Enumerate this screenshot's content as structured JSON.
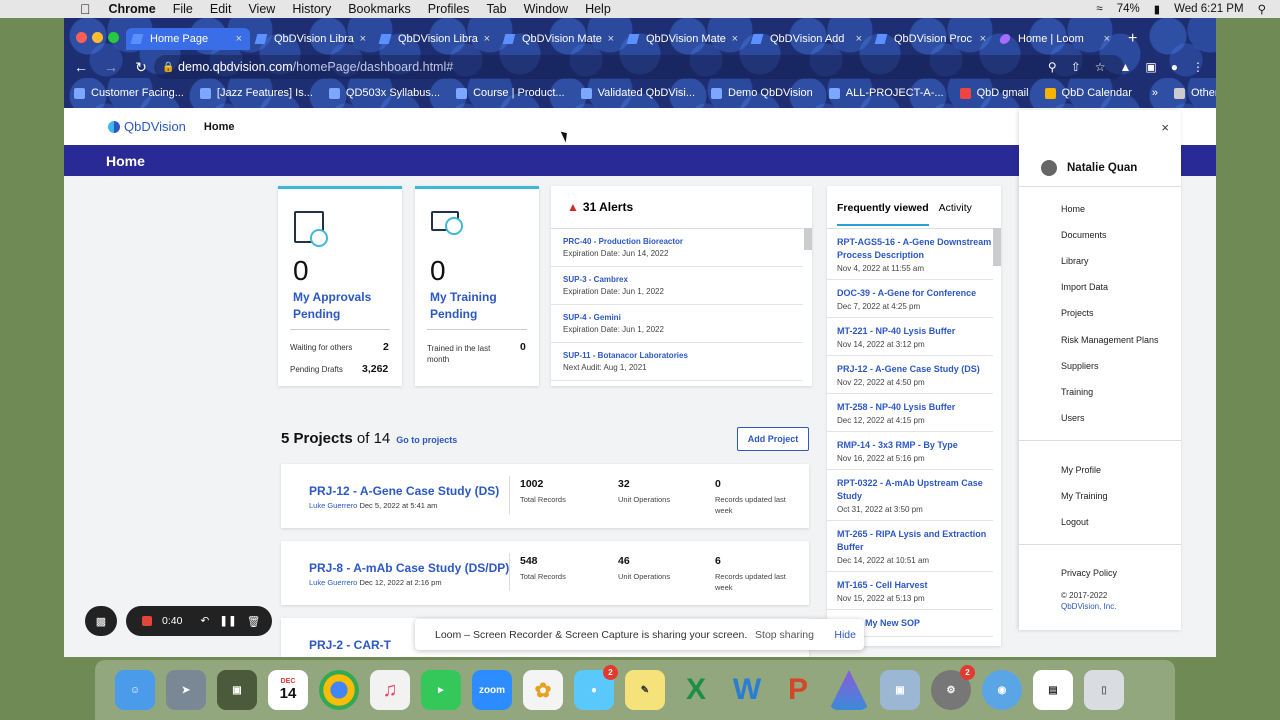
{
  "mac_menu": {
    "app": "Chrome",
    "items": [
      "File",
      "Edit",
      "View",
      "History",
      "Bookmarks",
      "Profiles",
      "Tab",
      "Window",
      "Help"
    ],
    "battery": "74%",
    "clock": "Wed 6:21 PM"
  },
  "tabs": [
    {
      "label": "Home Page",
      "active": true
    },
    {
      "label": "QbDVision Libra",
      "active": false
    },
    {
      "label": "QbDVision Libra",
      "active": false
    },
    {
      "label": "QbDVision Mate",
      "active": false
    },
    {
      "label": "QbDVision Mate",
      "active": false
    },
    {
      "label": "QbDVision Add",
      "active": false
    },
    {
      "label": "QbDVision Proc",
      "active": false
    },
    {
      "label": "Home | Loom",
      "active": false
    }
  ],
  "url": {
    "host": "demo.qbdvision.com",
    "path": "/homePage/dashboard.html#"
  },
  "bookmarks": [
    "Customer Facing...",
    "[Jazz Features] Is...",
    "QD503x Syllabus...",
    "Course | Product...",
    "Validated QbDVisi...",
    "Demo QbDVision",
    "ALL-PROJECT-A-...",
    "QbD gmail",
    "QbD Calendar",
    "Other Bookmarks"
  ],
  "app": {
    "logo": "QbDVision",
    "nav_home": "Home",
    "banner": "Home"
  },
  "approvals": {
    "count": "0",
    "label": "My Approvals Pending",
    "row1_label": "Waiting for others",
    "row1_value": "2",
    "row2_label": "Pending Drafts",
    "row2_value": "3,262"
  },
  "training": {
    "count": "0",
    "label": "My Training Pending",
    "row1_label": "Trained in the last month",
    "row1_value": "0"
  },
  "alerts": {
    "title": "31 Alerts",
    "items": [
      {
        "title": "PRC-40 - Production Bioreactor",
        "detail": "Expiration Date: Jun 14, 2022"
      },
      {
        "title": "SUP-3 - Cambrex",
        "detail": "Expiration Date: Jun 1, 2022"
      },
      {
        "title": "SUP-4 - Gemini",
        "detail": "Expiration Date: Jun 1, 2022"
      },
      {
        "title": "SUP-11 - Botanacor Laboratories",
        "detail": "Next Audit: Aug 1, 2021"
      }
    ]
  },
  "frequent": {
    "tab_active": "Frequently viewed",
    "tab_other": "Activity",
    "items": [
      {
        "title": "RPT-AGS5-16 - A-Gene Downstream Process Description",
        "date": "Nov 4, 2022 at 11:55 am"
      },
      {
        "title": "DOC-39 - A-Gene for Conference",
        "date": "Dec 7, 2022 at 4:25 pm"
      },
      {
        "title": "MT-221 - NP-40 Lysis Buffer",
        "date": "Nov 14, 2022 at 3:12 pm"
      },
      {
        "title": "PRJ-12 - A-Gene Case Study (DS)",
        "date": "Nov 22, 2022 at 4:50 pm"
      },
      {
        "title": "MT-258 - NP-40 Lysis Buffer",
        "date": "Dec 12, 2022 at 4:15 pm"
      },
      {
        "title": "RMP-14 - 3x3 RMP - By Type",
        "date": "Nov 16, 2022 at 5:16 pm"
      },
      {
        "title": "RPT-0322 - A-mAb Upstream Case Study",
        "date": "Oct 31, 2022 at 3:50 pm"
      },
      {
        "title": "MT-265 - RIPA Lysis and Extraction Buffer",
        "date": "Dec 14, 2022 at 10:51 am"
      },
      {
        "title": "MT-165 - Cell Harvest",
        "date": "Nov 15, 2022 at 5:13 pm"
      },
      {
        "title": "My New SOP",
        "date": ""
      }
    ]
  },
  "projects": {
    "count": "5 Projects",
    "of": "of 14",
    "go": "Go to projects",
    "add": "Add Project",
    "items": [
      {
        "title": "PRJ-12 - A-Gene Case Study (DS)",
        "user": "Luke Guerrero",
        "date": "Dec 5, 2022 at 5:41 am",
        "records": "1002",
        "records_label": "Total Records",
        "units": "32",
        "units_label": "Unit Operations",
        "updated": "0",
        "updated_label": "Records updated last week"
      },
      {
        "title": "PRJ-8 - A-mAb Case Study (DS/DP)",
        "user": "Luke Guerrero",
        "date": "Dec 12, 2022 at 2:16 pm",
        "records": "548",
        "records_label": "Total Records",
        "units": "46",
        "units_label": "Unit Operations",
        "updated": "6",
        "updated_label": "Records updated last week"
      },
      {
        "title": "PRJ-2 - CAR-T",
        "user": "",
        "date": "",
        "records": "",
        "records_label": "",
        "units": "",
        "units_label": "",
        "updated": "",
        "updated_label": ""
      }
    ]
  },
  "user_menu": {
    "name": "Natalie Quan",
    "items": [
      "Home",
      "Documents",
      "Library",
      "Import Data",
      "Projects",
      "Risk Management Plans",
      "Suppliers",
      "Training",
      "Users"
    ],
    "account": [
      "My Profile",
      "My Training",
      "Logout"
    ],
    "privacy": "Privacy Policy",
    "copyright": "© 2017-2022",
    "company": "QbDVision, Inc."
  },
  "loom": {
    "message": "Loom – Screen Recorder & Screen Capture is sharing your screen.",
    "stop": "Stop sharing",
    "hide": "Hide",
    "timer": "0:40"
  },
  "dock": {
    "calendar_month": "DEC",
    "calendar_day": "14",
    "messages_badge": "2",
    "prefs_badge": "2",
    "zoom": "zoom"
  }
}
